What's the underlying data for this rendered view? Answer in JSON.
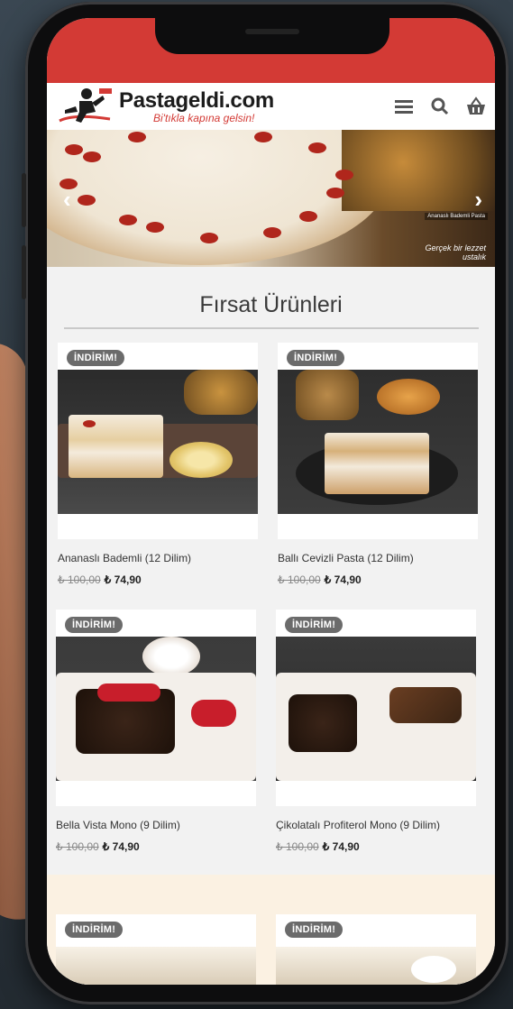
{
  "header": {
    "brand": "Pastageldi.com",
    "slogan": "Bi'tıkla kapına gelsin!",
    "icons": [
      "menu-icon",
      "search-icon",
      "basket-icon"
    ]
  },
  "banner": {
    "tag": "Ananaslı Bademli Pasta",
    "caption": "Gerçek bir lezzet ustalık",
    "prev_icon": "chevron-left-icon",
    "next_icon": "chevron-right-icon"
  },
  "section": {
    "title": "Fırsat Ürünleri"
  },
  "products": [
    {
      "badge": "İNDİRİM!",
      "name": "Ananaslı Bademli (12 Dilim)",
      "old_price": "₺ 100,00",
      "new_price": "₺ 74,90"
    },
    {
      "badge": "İNDİRİM!",
      "name": "Ballı Cevizli Pasta (12 Dilim)",
      "old_price": "₺ 100,00",
      "new_price": "₺ 74,90"
    },
    {
      "badge": "İNDİRİM!",
      "name": "Bella Vista Mono (9 Dilim)",
      "old_price": "₺ 100,00",
      "new_price": "₺ 74,90"
    },
    {
      "badge": "İNDİRİM!",
      "name": "Çikolatalı Profiterol Mono (9 Dilim)",
      "old_price": "₺ 100,00",
      "new_price": "₺ 74,90"
    },
    {
      "badge": "İNDİRİM!"
    },
    {
      "badge": "İNDİRİM!"
    }
  ],
  "colors": {
    "accent": "#d33a35",
    "badge": "#6b6b6b"
  }
}
